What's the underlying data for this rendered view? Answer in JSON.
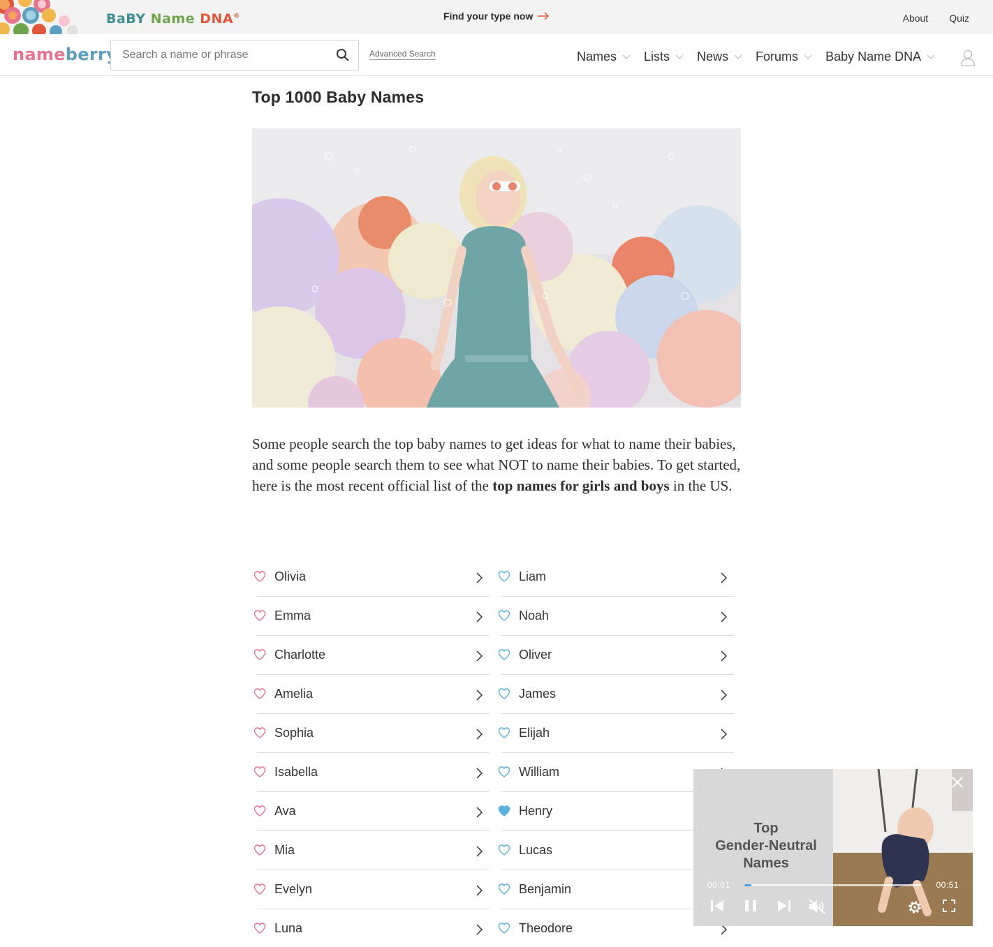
{
  "promo": {
    "brand_part1": "BaBY",
    "brand_part2": "Name",
    "brand_part3": "DNA",
    "brand_mark": "®",
    "cta": "Find your type now",
    "links": {
      "about": "About",
      "quiz": "Quiz"
    }
  },
  "header": {
    "logo_part1": "name",
    "logo_part2": "berry",
    "search_placeholder": "Search a name or phrase",
    "search_value": "",
    "advanced_search": "Advanced Search",
    "nav": [
      "Names",
      "Lists",
      "News",
      "Forums",
      "Baby Name DNA"
    ]
  },
  "main": {
    "title": "Top 1000 Baby Names",
    "intro_part1": "Some people search the top baby names to get ideas for what to name their babies, and some people search them to see what NOT to name their babies. To get started, here is the most recent official list of the ",
    "intro_bold": "top names for girls and boys",
    "intro_part2": " in the US."
  },
  "names": {
    "girls": [
      "Olivia",
      "Emma",
      "Charlotte",
      "Amelia",
      "Sophia",
      "Isabella",
      "Ava",
      "Mia",
      "Evelyn",
      "Luna"
    ],
    "boys": [
      "Liam",
      "Noah",
      "Oliver",
      "James",
      "Elijah",
      "William",
      "Henry",
      "Lucas",
      "Benjamin",
      "Theodore"
    ],
    "favorited_boys": [
      "Henry"
    ]
  },
  "video": {
    "title_line1": "Top",
    "title_line2": "Gender-Neutral",
    "title_line3": "Names",
    "time_current": "00:01",
    "time_total": "00:51",
    "progress_fraction": 0.04
  },
  "colors": {
    "girl_heart": "#e8738f",
    "boy_heart": "#5bb3dc",
    "progress": "#4aa3e8"
  }
}
